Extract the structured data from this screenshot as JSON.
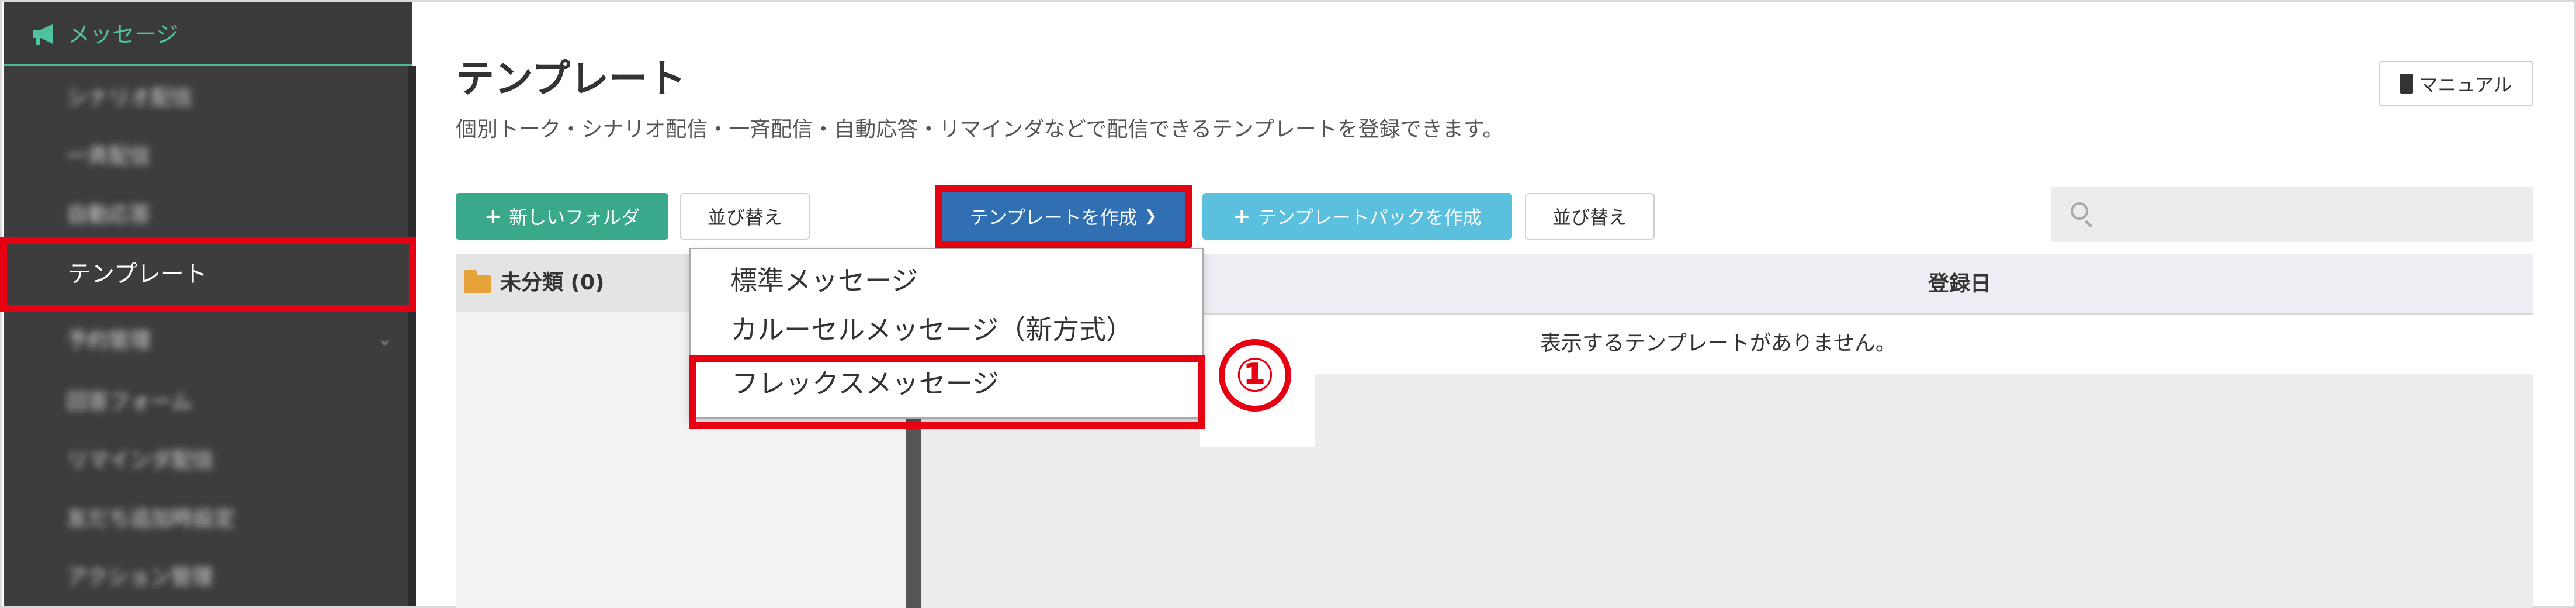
{
  "sidebar": {
    "header_label": "メッセージ",
    "items": [
      {
        "label": "シナリオ配信"
      },
      {
        "label": "一斉配信"
      },
      {
        "label": "自動応答"
      },
      {
        "label": "テンプレート"
      },
      {
        "label": "予約管理"
      },
      {
        "label": "回答フォーム"
      },
      {
        "label": "リマインダ配信"
      },
      {
        "label": "友だち追加時設定"
      },
      {
        "label": "アクション管理"
      }
    ]
  },
  "header": {
    "title": "テンプレート",
    "description": "個別トーク・シナリオ配信・一斉配信・自動応答・リマインダなどで配信できるテンプレートを登録できます。",
    "manual_label": "マニュアル"
  },
  "toolbar": {
    "new_folder_label": "新しいフォルダ",
    "sort_label_1": "並び替え",
    "create_template_label": "テンプレートを作成",
    "create_pack_label": "テンプレートパックを作成",
    "sort_label_2": "並び替え",
    "search_placeholder": ""
  },
  "folders": [
    {
      "label": "未分類 (0)"
    }
  ],
  "table": {
    "columns": [
      "登録日"
    ],
    "empty_message": "表示するテンプレートがありません。"
  },
  "dropdown": {
    "items": [
      {
        "label": "標準メッセージ"
      },
      {
        "label": "カルーセルメッセージ（新方式）"
      },
      {
        "label": "フレックスメッセージ"
      }
    ]
  },
  "annotation": {
    "step_marker": "①",
    "highlight_color": "#e60012"
  }
}
